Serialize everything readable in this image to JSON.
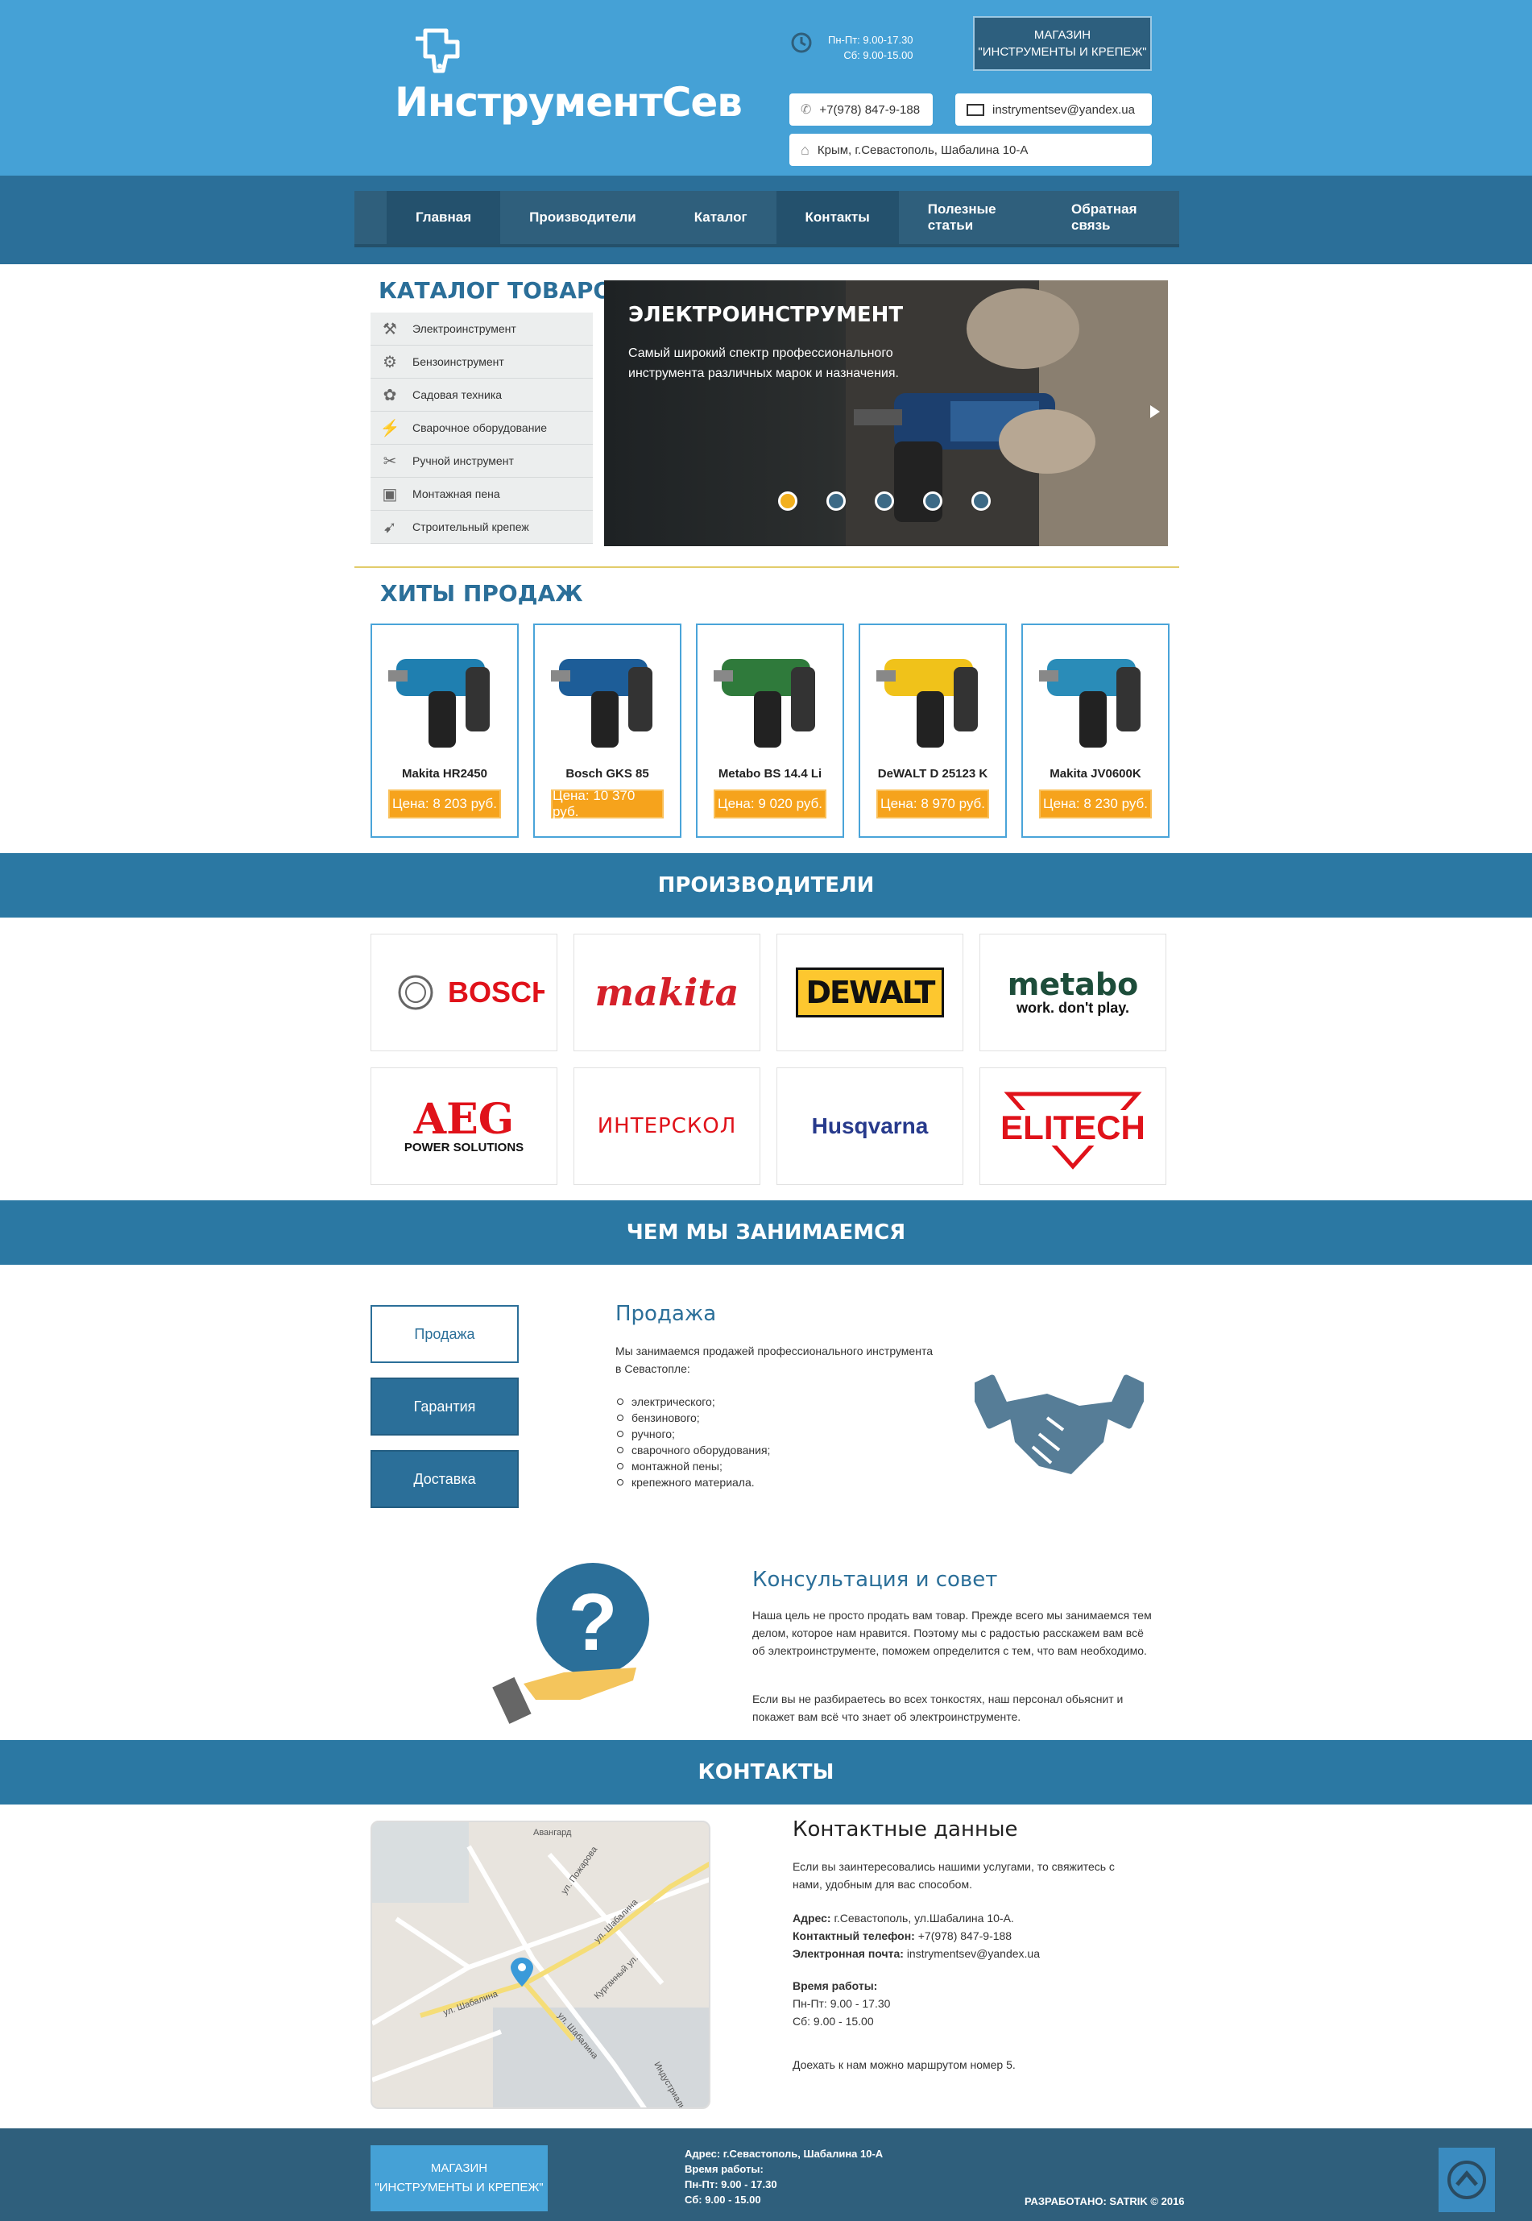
{
  "header": {
    "logo": "ИнструментСев",
    "hours": [
      "Пн-Пт: 9.00-17.30",
      "Сб: 9.00-15.00"
    ],
    "shop_button": [
      "МАГАЗИН",
      "\"ИНСТРУМЕНТЫ И КРЕПЕЖ\""
    ],
    "phone": "+7(978) 847-9-188",
    "email": "instrymentsev@yandex.ua",
    "address": "Крым, г.Севастополь, Шабалина 10-А"
  },
  "nav": [
    "Главная",
    "Производители",
    "Каталог",
    "Контакты",
    "Полезные статьи",
    "Обратная связь"
  ],
  "catalog": {
    "title": "КАТАЛОГ ТОВАРОВ",
    "items": [
      "Электроинструмент",
      "Бензоинструмент",
      "Садовая техника",
      "Сварочное оборудование",
      "Ручной инструмент",
      "Монтажная пена",
      "Строительный крепеж"
    ],
    "icons": [
      "drill-icon",
      "chainsaw-icon",
      "garden-icon",
      "welding-icon",
      "tools-icon",
      "foam-icon",
      "fastener-icon"
    ]
  },
  "slider": {
    "title": "ЭЛЕКТРОИНСТРУМЕНТ",
    "description": "Самый широкий спектр профессионального инструмента различных марок и назначения.",
    "active_slide": 1,
    "slide_count": 5
  },
  "hits": {
    "title": "ХИТЫ ПРОДАЖ",
    "products": [
      {
        "name": "Makita HR2450",
        "price": "Цена: 8 203 руб.",
        "color": "#1f7fb0"
      },
      {
        "name": "Bosch GKS 85",
        "price": "Цена: 10 370 руб.",
        "color": "#1d5d98"
      },
      {
        "name": "Metabo BS 14.4 Li",
        "price": "Цена: 9 020 руб.",
        "color": "#2f7a3b"
      },
      {
        "name": "DeWALT D 25123 K",
        "price": "Цена: 8 970 руб.",
        "color": "#f0c21a"
      },
      {
        "name": "Makita JV0600K",
        "price": "Цена: 8 230 руб.",
        "color": "#2a8cb8"
      }
    ]
  },
  "brands": {
    "title": "ПРОИЗВОДИТЕЛИ",
    "items": [
      "BOSCH",
      "makita",
      "DEWALT",
      "metabo",
      "AEG",
      "ИНТЕРСКОЛ",
      "Husqvarna",
      "ELITECH"
    ],
    "sub": {
      "metabo": "work. don't play.",
      "aeg": "POWER SOLUTIONS"
    }
  },
  "services": {
    "title": "ЧЕМ МЫ ЗАНИМАЕМСЯ",
    "tabs": [
      "Продажа",
      "Гарантия",
      "Доставка"
    ],
    "sale_title": "Продажа",
    "sale_text": "Мы занимаемся продажей профессионального инструмента в Севастопле:",
    "sale_list": [
      "электрического;",
      "бензинового;",
      "ручного;",
      "сварочного оборудования;",
      "монтажной пены;",
      "крепежного материала."
    ],
    "consult_title": "Консультация и совет",
    "consult_p1": "Наша цель не просто продать вам товар. Прежде всего мы занимаемся тем делом, которое нам нравится. Поэтому мы с радостью расскажем вам всё об электроинструменте, поможем определится с тем, что вам необходимо.",
    "consult_p2": "Если вы не разбираетесь во всех тонкостях, наш персонал обьяснит и покажет вам всё что знает об электроинструменте."
  },
  "contacts": {
    "title": "КОНТАКТЫ",
    "heading": "Контактные данные",
    "intro": "Если вы заинтересовались нашими услугами, то свяжитесь с нами, удобным для вас способом.",
    "address_label": "Адрес:",
    "address": "г.Севастополь, ул.Шабалина 10-А.",
    "phone_label": "Контактный телефон:",
    "phone": "+7(978) 847-9-188",
    "email_label": "Электронная почта:",
    "email": "instrymentsev@yandex.ua",
    "hours_label": "Время работы:",
    "hours": [
      "Пн-Пт: 9.00 - 17.30",
      "Сб: 9.00 - 15.00"
    ],
    "route": "Доехать к нам можно маршрутом номер 5.",
    "map_labels": [
      "Авангард",
      "ул. Пожарова",
      "ул. Шабалина",
      "ул. Шабалина",
      "Курганный ул.",
      "ул. Шабалина",
      "Индустриальная"
    ]
  },
  "footer": {
    "shop_button": [
      "МАГАЗИН",
      "\"ИНСТРУМЕНТЫ И КРЕПЕЖ\""
    ],
    "address": "Адрес: г.Севастополь, Шабалина 10-А",
    "hours_label": "Время работы:",
    "hours": [
      "Пн-Пт: 9.00 - 17.30",
      "Сб: 9.00 - 15.00"
    ],
    "credit": "РАЗРАБОТАНО: SATRIK © 2016"
  },
  "colors": {
    "primary": "#45a1d6",
    "dark": "#2b6f99",
    "accent": "#f6a31c"
  }
}
